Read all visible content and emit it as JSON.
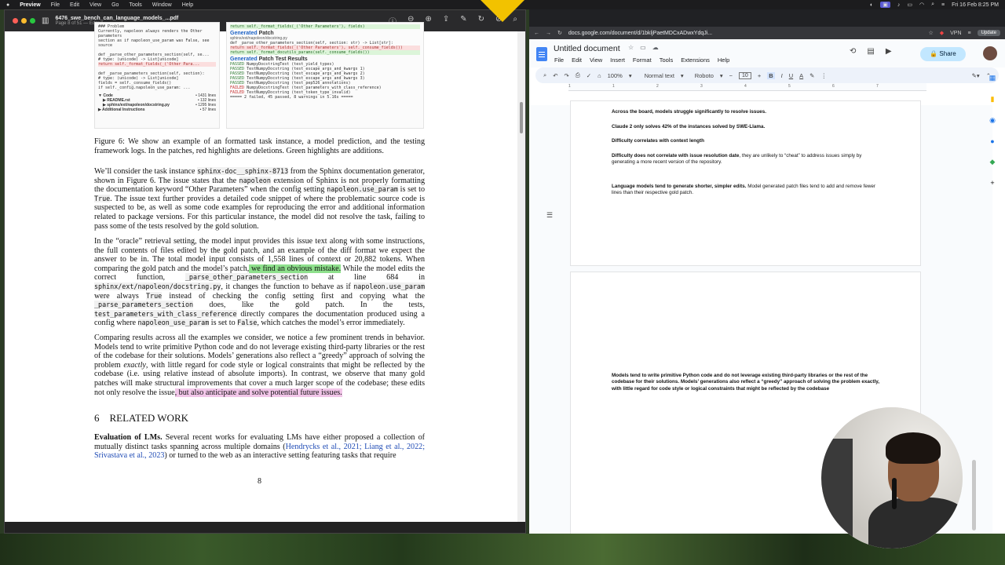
{
  "menubar": {
    "apple": "",
    "app": "Preview",
    "items": [
      "File",
      "Edit",
      "View",
      "Go",
      "Tools",
      "Window",
      "Help"
    ],
    "datetime": "Fri 16 Feb 8:25 PM"
  },
  "preview": {
    "doc_title": "6476_swe_bench_can_language_models_...pdf",
    "doc_sub": "Page 8 of 51 — Edited",
    "figure": {
      "left_lines": [
        "### Problem",
        "Currently, napoleon always renders the Other parameters",
        "section as if napoleon_use_param was False, see source",
        "",
        "def _parse_other_parameters_section(self, se...",
        "    # type: (unicode) -> List[unicode]",
        "    return self._format_fields(_('Other Para...",
        "",
        "def _parse_parameters_section(self, section):",
        "    # type: (unicode) -> List[unicode]",
        "    fields = self._consume_fields()",
        "    if self._config.napoleon_use_param: ..."
      ],
      "tree": [
        {
          "name": "▼ Code",
          "count": "• 1431 lines"
        },
        {
          "name": "▶ README.rst",
          "count": "• 132 lines"
        },
        {
          "name": "▶ sphinx/ext/napoleon/docstring.py",
          "count": "• 1295 lines"
        },
        {
          "name": "▶ Additional Instructions",
          "count": "• 57 lines"
        }
      ],
      "top_lines": [
        "        return self._format_fields(_('Other Parameters'), fields)"
      ],
      "gen_patch_title_a": "Generated",
      "gen_patch_title_b": " Patch",
      "gen_patch_file": "sphinx/ext/napoleon/docstring.py",
      "gen_patch_lines": [
        {
          "cls": "",
          "text": "def _parse_other_parameters_section(self, section: str) -> List[str]:"
        },
        {
          "cls": "del",
          "text": "    return self._format_fields(_('Other Parameters'), self._consume_fields())"
        },
        {
          "cls": "add",
          "text": "    return self._format_docutils_params(self._consume_fields())"
        }
      ],
      "test_title_a": "Generated",
      "test_title_b": " Patch Test Results",
      "tests": [
        {
          "status": "PASSED",
          "name": "NumpyDocstringTest (test_yield_types)"
        },
        {
          "status": "PASSED",
          "name": "TestNumpyDocstring (test_escape_args_and_kwargs 1)"
        },
        {
          "status": "PASSED",
          "name": "TestNumpyDocstring (test_escape_args_and_kwargs 2)"
        },
        {
          "status": "PASSED",
          "name": "TestNumpyDocstring (test_escape_args_and_kwargs 3)"
        },
        {
          "status": "PASSED",
          "name": "TestNumpyDocstring (test_pep526_annotations)"
        },
        {
          "status": "FAILED",
          "name": "NumpyDocstringTest (test_parameters_with_class_reference)"
        },
        {
          "status": "FAILED",
          "name": "TestNumpyDocstring (test_token_type_invalid)"
        }
      ],
      "summary": "===== 2 failed, 45 passed, 8 warnings in 5.16s ====="
    },
    "caption": "Figure 6: We show an example of an formatted task instance, a model prediction, and the testing framework logs. In the patches, red highlights are deletions. Green highlights are additions.",
    "p1": {
      "a": "We’ll consider the task instance ",
      "code1": "sphinx-doc__sphinx-8713",
      "b": " from the Sphinx documentation generator, shown in Figure 6.  The issue states that the ",
      "code2": "napoleon",
      "c": " extension of Sphinx is not properly formatting the documentation keyword “Other Parameters” when the config setting ",
      "code3": "napoleon.use_param",
      "d": " is set to ",
      "code4": "True",
      "e": ". The issue text further provides a detailed code snippet of where the problematic source code is suspected to be, as well as some code examples for reproducing the error and additional information related to package versions. For this particular instance, the model did not resolve the task, failing to pass some of the tests resolved by the gold solution."
    },
    "p2": {
      "a": "In the “oracle” retrieval setting, the model input provides this issue text along with some instructions, the full contents of files edited by the gold patch, and an example of the diff format we expect the answer to be in. The total model input consists of 1,558 lines of context or 20,882 tokens.  When comparing the gold patch and the model’s patch,",
      "hl": " we find an obvious mistake.",
      "b": "  While the model edits the correct function, ",
      "code1": "_parse_other_parameters_section",
      "c": " at line 684 in ",
      "code2": "sphinx/ext/napoleon/docstring.py",
      "d": ", it changes the function to behave as if ",
      "code3": "napoleon.use_param",
      "e": " were always ",
      "code4": "True",
      "f": " instead of checking the config setting first and copying what the ",
      "code5": "_parse_parameters_section",
      "g": " does, like the gold patch.  In the tests, ",
      "code6": "test_parameters_with_class_reference",
      "h": " directly compares the documentation produced using a config where ",
      "code7": "napoleon_use_param",
      "i": " is set to ",
      "code8": "False",
      "j": ", which catches the model’s error immediately."
    },
    "p3": {
      "a": "Comparing results across all the examples we consider, we notice a few prominent trends in behavior. Models tend to write primitive Python code and do not leverage existing third-party libraries or the rest of the codebase for their solutions.  Models’ generations also reflect a “greedy” approach of solving the problem ",
      "em": "exactly",
      "b": ", with little regard for code style or logical constraints that might be reflected by the codebase (i.e. using relative instead of absolute imports). In contrast, we observe that many gold patches will make structural improvements that cover a much larger scope of the codebase; these edits not only resolve the issue",
      "hl": ", but also anticipate and solve potential future issues."
    },
    "section_num": "6",
    "section_title": "RELATED WORK",
    "p4": {
      "bold": "Evaluation of LMs.",
      "a": "  Several recent works for evaluating LMs have either proposed a collection of mutually distinct tasks spanning across multiple domains (",
      "cite1": "Hendrycks et al., 2021; Liang et al., 2022; Srivastava et al., 2023",
      "b": ") or turned to the web as an interactive setting featuring tasks that require"
    },
    "page_number": "8"
  },
  "chrome": {
    "url": "docs.google.com/document/d/1bkljPaetMDCxADwxYdqJi...",
    "vpn": "VPN",
    "update": "Update",
    "doc_title": "Untitled document",
    "menu": [
      "File",
      "Edit",
      "View",
      "Insert",
      "Format",
      "Tools",
      "Extensions",
      "Help"
    ],
    "share": "Share",
    "toolbar": {
      "zoom": "100%",
      "style": "Normal text",
      "font": "Roboto",
      "size": "10"
    },
    "ruler_marks": [
      "1",
      "1",
      "2",
      "3",
      "4",
      "5",
      "6",
      "7"
    ],
    "page1": [
      {
        "bold": "Across the board, models struggle significantly to resolve issues.",
        "rest": ""
      },
      {
        "bold": "Claude 2 only solves 42% of the instances solved by SWE-Llama.",
        "rest": ""
      },
      {
        "bold": "Difficulty correlates with context length",
        "rest": ""
      },
      {
        "bold": "Difficulty does not correlate with issue resolution date",
        "rest": ", they are unlikely to “cheat” to address issues simply by generating a more recent version of the repository."
      },
      {
        "bold": "Language models tend to generate shorter, simpler edits.",
        "rest": " Model generated patch files tend to add and remove fewer lines than their respective gold patch."
      }
    ],
    "page2": {
      "bold": " Models tend to write primitive Python code and do not leverage existing third-party libraries or the rest of the codebase for their solutions. Models’ generations also reflect a “greedy” approach of solving the problem exactly, with little regard for code style or logical constraints that might be reflected by the codebase"
    }
  }
}
